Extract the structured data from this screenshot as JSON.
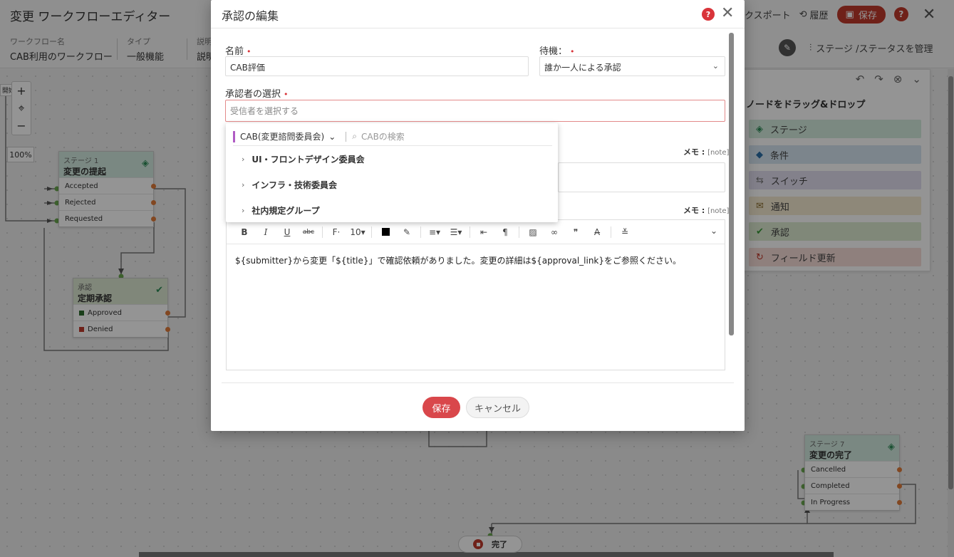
{
  "app": {
    "title": "変更 ワークフローエディター",
    "export_label": "クスポート",
    "history_label": "履歴",
    "save_label": "保存",
    "help_label": "?",
    "close_label": "✕"
  },
  "meta": {
    "workflow_name_label": "ワークフロー名",
    "workflow_name": "CAB利用のワークフロー",
    "type_label": "タイプ",
    "type_value": "一般機能",
    "desc_label": "説明",
    "desc_value": "説明",
    "manage_label": "ステージ /ステータスを管理"
  },
  "canvas": {
    "zoom_level": "100%",
    "edge_label": "開始",
    "stage1": {
      "small": "ステージ 1",
      "name": "変更の提起",
      "rows": [
        "Accepted",
        "Rejected",
        "Requested"
      ]
    },
    "approval": {
      "small": "承認",
      "name": "定期承認",
      "rows": [
        "Approved",
        "Denied"
      ],
      "colors": [
        "#2e6b2e",
        "#c0392b"
      ]
    },
    "stage7": {
      "small": "ステージ 7",
      "name": "変更の完了",
      "rows": [
        "Cancelled",
        "Completed",
        "In Progress"
      ]
    },
    "end_label": "完了"
  },
  "palette": {
    "title": "ノードをドラッグ&ドロップ",
    "items": [
      {
        "label": "ステージ",
        "icon": "layers-icon",
        "color": "#d5ecdf"
      },
      {
        "label": "条件",
        "icon": "diamond-icon",
        "color": "#d6e6f2"
      },
      {
        "label": "スイッチ",
        "icon": "switch-icon",
        "color": "#e2def0"
      },
      {
        "label": "通知",
        "icon": "envelope-icon",
        "color": "#f5ead0"
      },
      {
        "label": "承認",
        "icon": "check-icon",
        "color": "#dcebd1"
      },
      {
        "label": "フィールド更新",
        "icon": "refresh-icon",
        "color": "#f6dcd8"
      }
    ]
  },
  "modal": {
    "title": "承認の編集",
    "help": "?",
    "close": "✕",
    "name_label": "名前",
    "name_value": "CAB評価",
    "wait_label": "待機：",
    "wait_value": "誰か一人による承認",
    "approver_label": "承認者の選択",
    "approver_placeholder": "受信者を選択する",
    "memo_label": "メモ : ",
    "memo_note": "[note]",
    "body_text": "${submitter}から変更「${title}」で確認依頼がありました。変更の詳細は${approval_link}をご参照ください。",
    "font_size": "10",
    "save_label": "保存",
    "cancel_label": "キャンセル"
  },
  "dropdown": {
    "group": "CAB(変更諮問委員会)",
    "search_placeholder": "CABの検索",
    "items": [
      "UI・フロントデザイン委員会",
      "インフラ・技術委員会",
      "社内規定グループ"
    ]
  },
  "colors": {
    "accent_red": "#d9474b",
    "selector_bar": "#b05cc4"
  }
}
